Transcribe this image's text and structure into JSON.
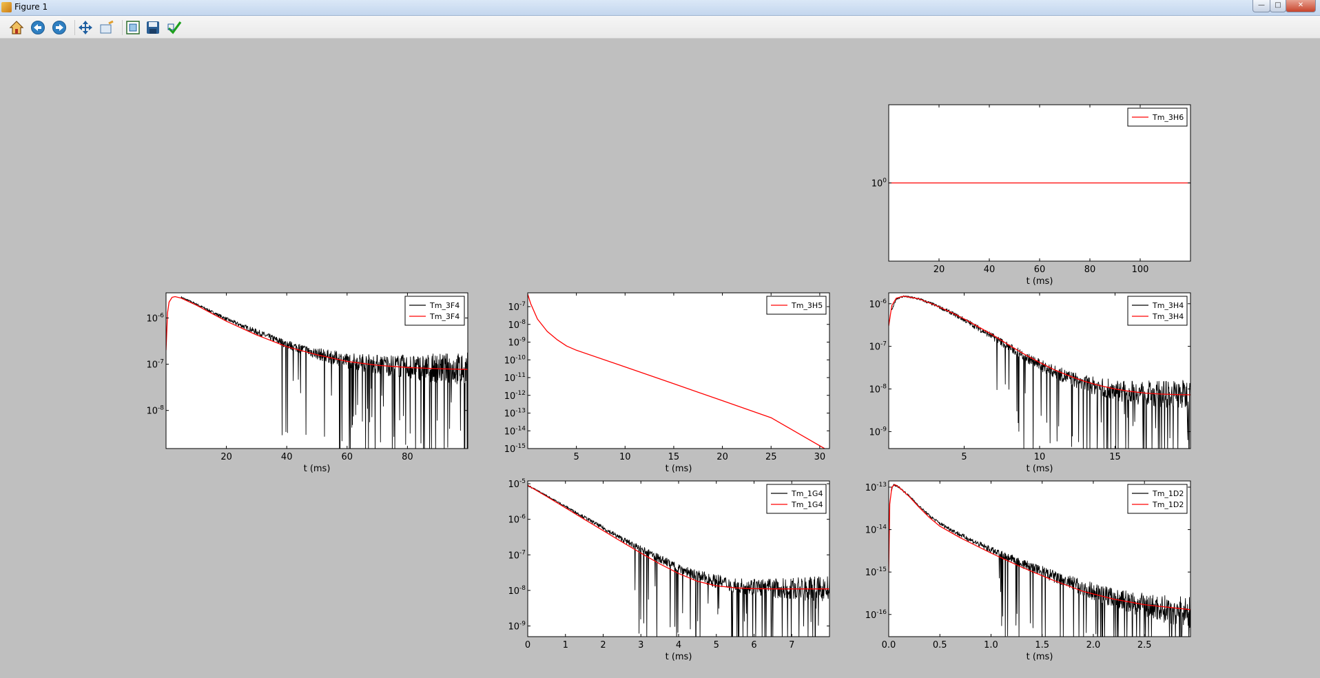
{
  "window": {
    "title": "Figure 1",
    "minimize_icon": "minimize-icon",
    "maximize_icon": "maximize-icon",
    "close_icon": "close-icon"
  },
  "toolbar": {
    "buttons": [
      {
        "name": "home-button",
        "icon": "home-icon"
      },
      {
        "name": "back-button",
        "icon": "back-arrow-icon"
      },
      {
        "name": "forward-button",
        "icon": "forward-arrow-icon"
      },
      {
        "name": "pan-button",
        "icon": "pan-arrows-icon"
      },
      {
        "name": "zoom-button",
        "icon": "zoom-rect-icon"
      },
      {
        "name": "subplots-button",
        "icon": "subplots-icon"
      },
      {
        "name": "save-button",
        "icon": "floppy-disk-icon"
      },
      {
        "name": "edit-axis-button",
        "icon": "checkmark-icon"
      }
    ]
  },
  "colors": {
    "measured": "#000000",
    "model": "#ff0000",
    "figure_bg": "#bfbfbf"
  },
  "chart_data": [
    {
      "id": "tm-3h6",
      "type": "line",
      "yscale": "log",
      "grid": false,
      "xlabel": "t (ms)",
      "xlim": [
        0,
        120
      ],
      "ylim": [
        0.1,
        10
      ],
      "xticks": [
        20,
        40,
        60,
        80,
        100
      ],
      "yticks": [
        {
          "v": 1,
          "label": "10",
          "exp": "0"
        }
      ],
      "legend": {
        "placement": "top-right"
      },
      "series": [
        {
          "name": "Tm_3H6",
          "color": "#ff0000",
          "kind": "model",
          "x": [
            0,
            120
          ],
          "y": [
            1,
            1
          ]
        }
      ]
    },
    {
      "id": "tm-3f4",
      "type": "line",
      "yscale": "log",
      "grid": false,
      "xlabel": "t (ms)",
      "xlim": [
        0,
        100
      ],
      "ylim": [
        1.5e-09,
        3.5e-06
      ],
      "xticks": [
        20,
        40,
        60,
        80
      ],
      "yticks": [
        {
          "v": 1e-06,
          "label": "10",
          "exp": "-6"
        },
        {
          "v": 1e-07,
          "label": "10",
          "exp": "-7"
        },
        {
          "v": 1e-08,
          "label": "10",
          "exp": "-8"
        }
      ],
      "legend": {
        "placement": "top-right"
      },
      "series": [
        {
          "name": "Tm_3F4",
          "color": "#000000",
          "kind": "noisy",
          "x": [
            5,
            10,
            20,
            30,
            40,
            50,
            60,
            70,
            80,
            90,
            100
          ],
          "y": [
            2.8e-06,
            2e-06,
            9.5e-07,
            5e-07,
            2.7e-07,
            1.7e-07,
            1.2e-07,
            1e-07,
            8.8e-08,
            8.2e-08,
            7.8e-08
          ]
        },
        {
          "name": "Tm_3F4",
          "color": "#ff0000",
          "kind": "model",
          "x": [
            0,
            0.5,
            1,
            2,
            3,
            5,
            10,
            20,
            30,
            40,
            50,
            60,
            70,
            80,
            90,
            100
          ],
          "y": [
            2e-07,
            1.3e-06,
            2.2e-06,
            2.8e-06,
            2.9e-06,
            2.7e-06,
            1.9e-06,
            8.5e-07,
            4.3e-07,
            2.4e-07,
            1.6e-07,
            1.15e-07,
            9.5e-08,
            8.5e-08,
            8e-08,
            7.7e-08
          ]
        }
      ]
    },
    {
      "id": "tm-3h5",
      "type": "line",
      "yscale": "log",
      "grid": false,
      "xlabel": "t (ms)",
      "xlim": [
        0,
        31
      ],
      "ylim": [
        1e-15,
        6e-07
      ],
      "xticks": [
        5,
        10,
        15,
        20,
        25,
        30
      ],
      "yticks": [
        {
          "v": 1e-07,
          "label": "10",
          "exp": "-7"
        },
        {
          "v": 1e-08,
          "label": "10",
          "exp": "-8"
        },
        {
          "v": 1e-09,
          "label": "10",
          "exp": "-9"
        },
        {
          "v": 1e-10,
          "label": "10",
          "exp": "-10"
        },
        {
          "v": 1e-11,
          "label": "10",
          "exp": "-11"
        },
        {
          "v": 1e-12,
          "label": "10",
          "exp": "-12"
        },
        {
          "v": 1e-13,
          "label": "10",
          "exp": "-13"
        },
        {
          "v": 1e-14,
          "label": "10",
          "exp": "-14"
        },
        {
          "v": 1e-15,
          "label": "10",
          "exp": "-15"
        }
      ],
      "legend": {
        "placement": "top-right"
      },
      "series": [
        {
          "name": "Tm_3H5",
          "color": "#ff0000",
          "kind": "model",
          "x": [
            0,
            0.3,
            1,
            2,
            3,
            4,
            5,
            10,
            15,
            20,
            25,
            30.5
          ],
          "y": [
            5e-07,
            1.5e-07,
            2e-08,
            4e-09,
            1.4e-09,
            6e-10,
            3.5e-10,
            4e-11,
            4.5e-12,
            5e-13,
            5.5e-14,
            1e-15
          ]
        }
      ]
    },
    {
      "id": "tm-3h4",
      "type": "line",
      "yscale": "log",
      "grid": false,
      "xlabel": "t (ms)",
      "xlim": [
        0,
        20
      ],
      "ylim": [
        4e-10,
        1.8e-06
      ],
      "xticks": [
        5,
        10,
        15
      ],
      "yticks": [
        {
          "v": 1e-06,
          "label": "10",
          "exp": "-6"
        },
        {
          "v": 1e-07,
          "label": "10",
          "exp": "-7"
        },
        {
          "v": 1e-08,
          "label": "10",
          "exp": "-8"
        },
        {
          "v": 1e-09,
          "label": "10",
          "exp": "-9"
        }
      ],
      "legend": {
        "placement": "top-right"
      },
      "series": [
        {
          "name": "Tm_3H4",
          "color": "#000000",
          "kind": "noisy",
          "x": [
            0.2,
            0.5,
            1,
            2,
            3,
            4,
            5,
            6,
            7,
            8,
            9,
            10,
            11,
            12,
            13,
            14,
            15,
            16,
            17,
            18,
            19,
            20
          ],
          "y": [
            7e-07,
            1.3e-06,
            1.5e-06,
            1.3e-06,
            9.5e-07,
            6.5e-07,
            4.2e-07,
            2.6e-07,
            1.6e-07,
            9.5e-08,
            5.8e-08,
            3.7e-08,
            2.5e-08,
            1.8e-08,
            1.35e-08,
            1.1e-08,
            9.5e-09,
            8.5e-09,
            8e-09,
            7.6e-09,
            7.4e-09,
            7.3e-09
          ]
        },
        {
          "name": "Tm_3H4",
          "color": "#ff0000",
          "kind": "model",
          "x": [
            0,
            0.2,
            0.5,
            1,
            2,
            3,
            4,
            5,
            6,
            7,
            8,
            9,
            10,
            11,
            12,
            13,
            14,
            15,
            16,
            17,
            18,
            19,
            20
          ],
          "y": [
            3e-07,
            9e-07,
            1.35e-06,
            1.5e-06,
            1.3e-06,
            9.5e-07,
            6.6e-07,
            4.4e-07,
            2.8e-07,
            1.75e-07,
            1.05e-07,
            6.5e-08,
            4.2e-08,
            2.8e-08,
            2e-08,
            1.5e-08,
            1.2e-08,
            1e-08,
            8.8e-09,
            8e-09,
            7.6e-09,
            7.4e-09,
            7.3e-09
          ]
        }
      ]
    },
    {
      "id": "tm-1g4",
      "type": "line",
      "yscale": "log",
      "grid": false,
      "xlabel": "t (ms)",
      "xlim": [
        0,
        8
      ],
      "ylim": [
        5e-10,
        1.2e-05
      ],
      "xticks": [
        0,
        1,
        2,
        3,
        4,
        5,
        6,
        7
      ],
      "yticks": [
        {
          "v": 1e-05,
          "label": "10",
          "exp": "-5"
        },
        {
          "v": 1e-06,
          "label": "10",
          "exp": "-6"
        },
        {
          "v": 1e-07,
          "label": "10",
          "exp": "-7"
        },
        {
          "v": 1e-08,
          "label": "10",
          "exp": "-8"
        },
        {
          "v": 1e-09,
          "label": "10",
          "exp": "-9"
        }
      ],
      "legend": {
        "placement": "top-right"
      },
      "series": [
        {
          "name": "Tm_1G4",
          "color": "#000000",
          "kind": "noisy",
          "x": [
            0,
            0.5,
            1,
            1.5,
            2,
            2.5,
            3,
            3.5,
            4,
            4.5,
            5,
            5.5,
            6,
            6.5,
            7,
            7.5,
            8
          ],
          "y": [
            9e-06,
            4.6e-06,
            2.3e-06,
            1.15e-06,
            5.7e-07,
            2.8e-07,
            1.45e-07,
            7.8e-08,
            4.3e-08,
            2.6e-08,
            1.8e-08,
            1.4e-08,
            1.25e-08,
            1.15e-08,
            1.12e-08,
            1.1e-08,
            1.1e-08
          ]
        },
        {
          "name": "Tm_1G4",
          "color": "#ff0000",
          "kind": "model",
          "x": [
            0,
            0.5,
            1,
            1.5,
            2,
            2.5,
            3,
            3.5,
            4,
            4.5,
            5,
            5.5,
            6,
            6.5,
            7,
            7.5,
            8
          ],
          "y": [
            9e-06,
            4.4e-06,
            2.1e-06,
            1e-06,
            4.8e-07,
            2.3e-07,
            1.12e-07,
            5.6e-08,
            3e-08,
            1.8e-08,
            1.35e-08,
            1.18e-08,
            1.12e-08,
            1.1e-08,
            1.1e-08,
            1.1e-08,
            1.1e-08
          ]
        }
      ]
    },
    {
      "id": "tm-1d2",
      "type": "line",
      "yscale": "log",
      "grid": false,
      "xlabel": "t (ms)",
      "xlim": [
        0,
        2.95
      ],
      "ylim": [
        3e-17,
        1.4e-13
      ],
      "xticks": [
        0.0,
        0.5,
        1.0,
        1.5,
        2.0,
        2.5
      ],
      "xtick_labels": [
        "0.0",
        "0.5",
        "1.0",
        "1.5",
        "2.0",
        "2.5"
      ],
      "yticks": [
        {
          "v": 1e-13,
          "label": "10",
          "exp": "-13"
        },
        {
          "v": 1e-14,
          "label": "10",
          "exp": "-14"
        },
        {
          "v": 1e-15,
          "label": "10",
          "exp": "-15"
        },
        {
          "v": 1e-16,
          "label": "10",
          "exp": "-16"
        }
      ],
      "legend": {
        "placement": "top-right"
      },
      "series": [
        {
          "name": "Tm_1D2",
          "color": "#000000",
          "kind": "noisy",
          "x": [
            0.02,
            0.05,
            0.1,
            0.2,
            0.3,
            0.4,
            0.5,
            0.7,
            1.0,
            1.3,
            1.6,
            1.9,
            2.2,
            2.5,
            2.95
          ],
          "y": [
            8e-14,
            1.15e-13,
            1e-13,
            6.2e-14,
            3.5e-14,
            2.1e-14,
            1.4e-14,
            7.5e-15,
            3.3e-15,
            1.6e-15,
            8e-16,
            4.2e-16,
            2.5e-16,
            1.6e-16,
            1.1e-16
          ]
        },
        {
          "name": "Tm_1D2",
          "color": "#ff0000",
          "kind": "model",
          "x": [
            0,
            0.01,
            0.03,
            0.06,
            0.1,
            0.2,
            0.3,
            0.4,
            0.5,
            0.7,
            1.0,
            1.3,
            1.6,
            1.9,
            2.2,
            2.5,
            2.95
          ],
          "y": [
            1e-15,
            4e-14,
            1e-13,
            1.15e-13,
            1e-13,
            6e-14,
            3.3e-14,
            1.9e-14,
            1.2e-14,
            6.4e-15,
            2.8e-15,
            1.3e-15,
            6.5e-16,
            3.5e-16,
            2.3e-16,
            1.7e-16,
            1.3e-16
          ]
        }
      ]
    }
  ]
}
